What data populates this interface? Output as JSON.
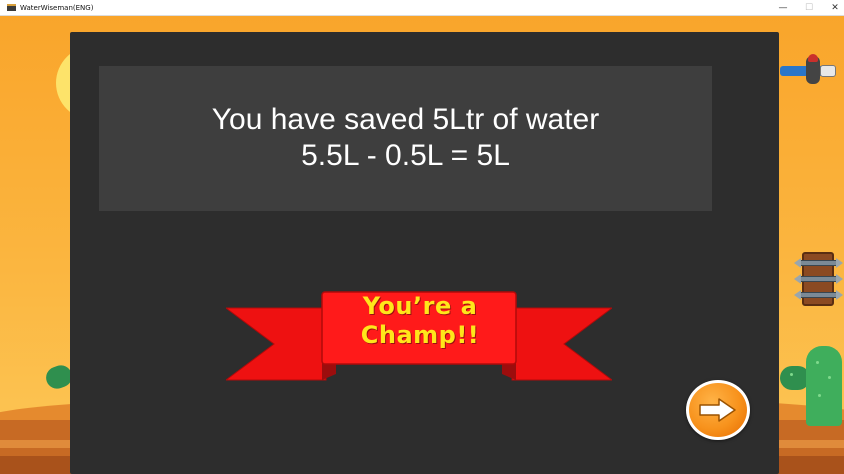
{
  "window": {
    "title": "WaterWiseman(ENG)",
    "minimize_glyph": "—",
    "maximize_glyph": "☐",
    "close_glyph": "✕"
  },
  "dialog": {
    "message_line1": "You have saved 5Ltr of water",
    "message_line2": "5.5L - 0.5L = 5L",
    "banner_line1": "You’re a",
    "banner_line2": "Champ!!",
    "next_icon": "arrow-right-icon"
  },
  "colors": {
    "panel_bg": "#2d2d2d",
    "message_bg": "#3e3e3e",
    "ribbon_red": "#ff1a1a",
    "banner_text": "#ffe61a",
    "button_orange": "#f7921c"
  }
}
